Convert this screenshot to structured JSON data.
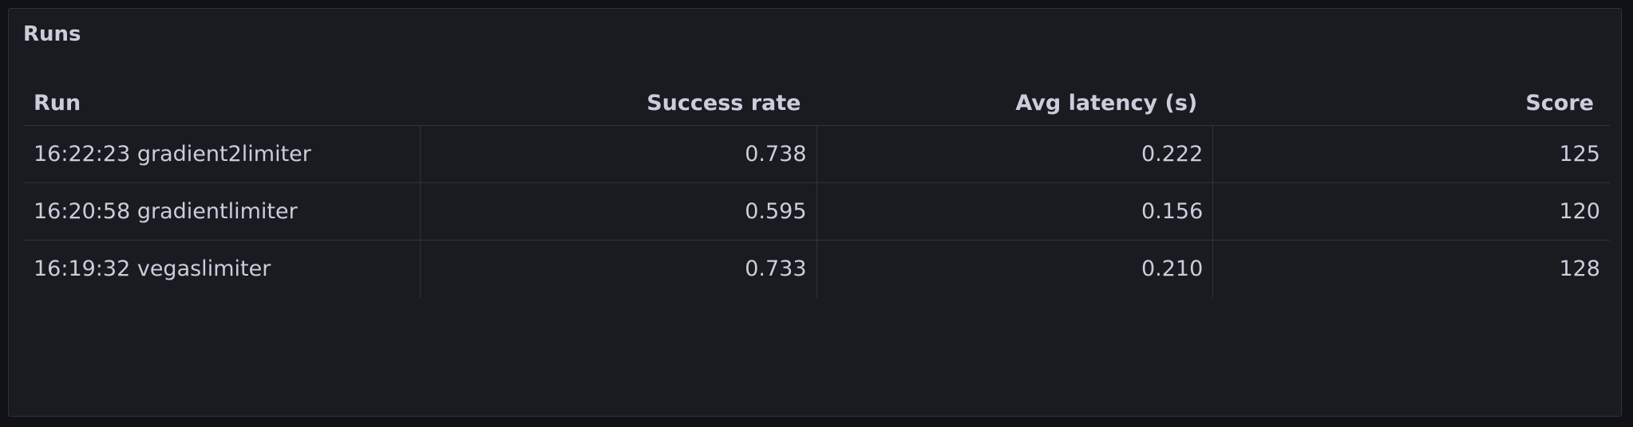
{
  "panel": {
    "title": "Runs"
  },
  "table": {
    "columns": [
      "Run",
      "Success rate",
      "Avg latency (s)",
      "Score"
    ],
    "rows": [
      [
        "16:22:23 gradient2limiter",
        "0.738",
        "0.222",
        "125"
      ],
      [
        "16:20:58 gradientlimiter",
        "0.595",
        "0.156",
        "120"
      ],
      [
        "16:19:32 vegaslimiter",
        "0.733",
        "0.210",
        "128"
      ]
    ]
  }
}
